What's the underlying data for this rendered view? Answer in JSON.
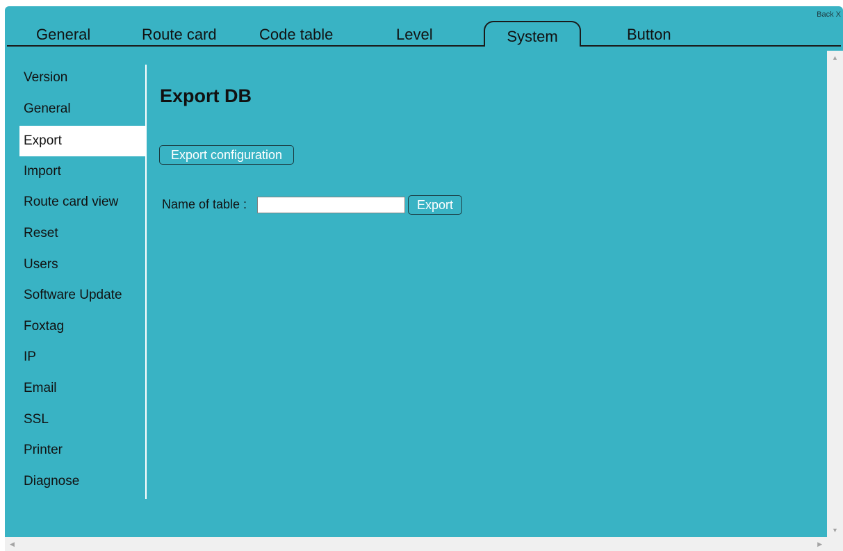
{
  "window": {
    "back_label": "Back X"
  },
  "tabs": [
    {
      "label": "General"
    },
    {
      "label": "Route card"
    },
    {
      "label": "Code table"
    },
    {
      "label": "Level"
    },
    {
      "label": "System",
      "active": true
    },
    {
      "label": "Button"
    }
  ],
  "sidebar": {
    "active": "Export",
    "items": [
      {
        "label": "Version"
      },
      {
        "label": "General"
      },
      {
        "label": "Export"
      },
      {
        "label": "Import"
      },
      {
        "label": "Route card view"
      },
      {
        "label": "Reset"
      },
      {
        "label": "Users"
      },
      {
        "label": "Software Update"
      },
      {
        "label": "Foxtag"
      },
      {
        "label": "IP"
      },
      {
        "label": "Email"
      },
      {
        "label": "SSL"
      },
      {
        "label": "Printer"
      },
      {
        "label": "Diagnose"
      }
    ]
  },
  "main": {
    "title": "Export DB",
    "export_config_label": "Export configuration",
    "name_label": "Name of table :",
    "table_name_value": "",
    "export_label": "Export"
  },
  "colors": {
    "background": "#39b3c4",
    "active_item": "#ffffff",
    "text": "#111111",
    "button_text": "#ffffff"
  },
  "icons": {
    "scroll_up": "triangle-up-icon",
    "scroll_down": "triangle-down-icon",
    "scroll_left": "triangle-left-icon",
    "scroll_right": "triangle-right-icon"
  }
}
